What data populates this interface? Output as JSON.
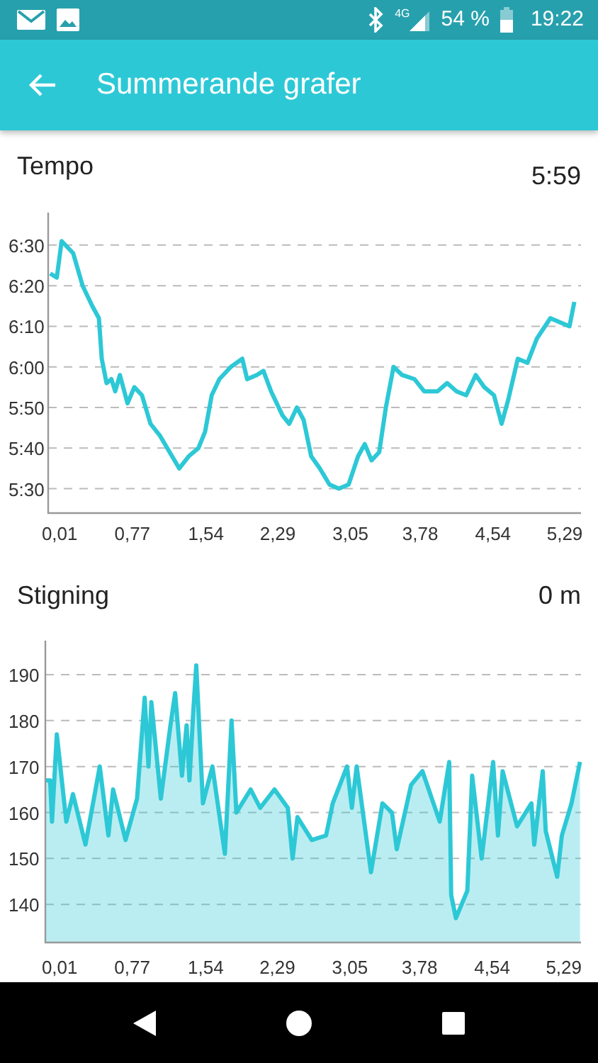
{
  "status_bar": {
    "network": "4G",
    "battery": "54 %",
    "time": "19:22"
  },
  "toolbar": {
    "title": "Summerande grafer"
  },
  "sections": [
    {
      "title": "Tempo",
      "value": "5:59",
      "chart_data": {
        "type": "line",
        "grid": true,
        "xlim": [
          -0.11,
          5.46
        ],
        "ylim": [
          324,
          398
        ],
        "yticks": [
          {
            "value": 330,
            "label": "5:30"
          },
          {
            "value": 340,
            "label": "5:40"
          },
          {
            "value": 350,
            "label": "5:50"
          },
          {
            "value": 360,
            "label": "6:00"
          },
          {
            "value": 370,
            "label": "6:10"
          },
          {
            "value": 380,
            "label": "6:20"
          },
          {
            "value": 390,
            "label": "6:30"
          }
        ],
        "xticks": [
          {
            "value": 0.01,
            "label": "0,01"
          },
          {
            "value": 0.77,
            "label": "0,77"
          },
          {
            "value": 1.54,
            "label": "1,54"
          },
          {
            "value": 2.29,
            "label": "2,29"
          },
          {
            "value": 3.05,
            "label": "3,05"
          },
          {
            "value": 3.78,
            "label": "3,78"
          },
          {
            "value": 4.54,
            "label": "4,54"
          },
          {
            "value": 5.29,
            "label": "5,29"
          }
        ],
        "x": [
          -0.09,
          -0.02,
          0.03,
          0.15,
          0.25,
          0.35,
          0.42,
          0.45,
          0.5,
          0.55,
          0.59,
          0.64,
          0.72,
          0.79,
          0.87,
          0.96,
          1.06,
          1.16,
          1.26,
          1.36,
          1.46,
          1.53,
          1.6,
          1.68,
          1.8,
          1.92,
          1.97,
          2.07,
          2.14,
          2.22,
          2.34,
          2.41,
          2.49,
          2.56,
          2.64,
          2.73,
          2.83,
          2.93,
          3.03,
          3.13,
          3.2,
          3.27,
          3.35,
          3.42,
          3.5,
          3.59,
          3.72,
          3.82,
          3.96,
          4.06,
          4.16,
          4.26,
          4.36,
          4.45,
          4.55,
          4.63,
          4.7,
          4.8,
          4.9,
          5,
          5.14,
          5.24,
          5.34,
          5.39
        ],
        "series": [
          {
            "color": "#2dc8d6",
            "values": [
              383,
              382,
              391,
              388,
              380,
              375,
              372,
              362,
              356,
              357,
              354,
              358,
              351,
              355,
              353,
              346,
              343,
              339,
              335,
              338,
              340,
              344,
              353,
              357,
              360,
              362,
              357,
              358,
              359,
              354,
              348,
              346,
              350,
              347,
              338,
              335,
              331,
              330,
              331,
              338,
              341,
              337,
              339,
              350,
              360,
              358,
              357,
              354,
              354,
              356,
              354,
              353,
              358,
              355,
              353,
              346,
              352,
              362,
              361,
              367,
              372,
              371,
              370,
              376
            ]
          }
        ]
      }
    },
    {
      "title": "Stigning",
      "value": "0 m",
      "chart_data": {
        "type": "area",
        "grid": true,
        "xlim": [
          -0.14,
          5.47
        ],
        "ylim": [
          131.7,
          197.4
        ],
        "yticks": [
          140,
          150,
          160,
          170,
          180,
          190
        ],
        "xticks": [
          {
            "value": 0.01,
            "label": "0,01"
          },
          {
            "value": 0.77,
            "label": "0,77"
          },
          {
            "value": 1.54,
            "label": "1,54"
          },
          {
            "value": 2.29,
            "label": "2,29"
          },
          {
            "value": 3.05,
            "label": "3,05"
          },
          {
            "value": 3.78,
            "label": "3,78"
          },
          {
            "value": 4.54,
            "label": "4,54"
          },
          {
            "value": 5.29,
            "label": "5,29"
          }
        ],
        "x": [
          -0.14,
          -0.09,
          -0.07,
          -0.02,
          0.08,
          0.15,
          0.28,
          0.43,
          0.52,
          0.57,
          0.7,
          0.82,
          0.9,
          0.94,
          0.97,
          1.07,
          1.17,
          1.22,
          1.29,
          1.34,
          1.37,
          1.41,
          1.44,
          1.51,
          1.61,
          1.74,
          1.81,
          1.86,
          2.01,
          2.11,
          2.26,
          2.4,
          2.45,
          2.5,
          2.65,
          2.8,
          2.87,
          3.02,
          3.07,
          3.12,
          3.27,
          3.39,
          3.49,
          3.54,
          3.69,
          3.81,
          3.99,
          4.09,
          4.11,
          4.16,
          4.28,
          4.33,
          4.43,
          4.55,
          4.6,
          4.65,
          4.8,
          4.95,
          4.98,
          5.07,
          5.1,
          5.22,
          5.27,
          5.37,
          5.46
        ],
        "series": [
          {
            "color": "#2dc8d6",
            "values": [
              167,
              167,
              158,
              177,
              158,
              164,
              153,
              170,
              155,
              165,
              154,
              163,
              185,
              170,
              184,
              163,
              179,
              186,
              168,
              179,
              167,
              182,
              192,
              162,
              170,
              151,
              180,
              160,
              165,
              161,
              165,
              161,
              150,
              159,
              154,
              155,
              162,
              170,
              161,
              170,
              147,
              162,
              160,
              152,
              166,
              169,
              158,
              171,
              142,
              137,
              143,
              168,
              150,
              171,
              155,
              169,
              157,
              162,
              153,
              169,
              156,
              146,
              155,
              162,
              171
            ]
          }
        ]
      }
    }
  ]
}
